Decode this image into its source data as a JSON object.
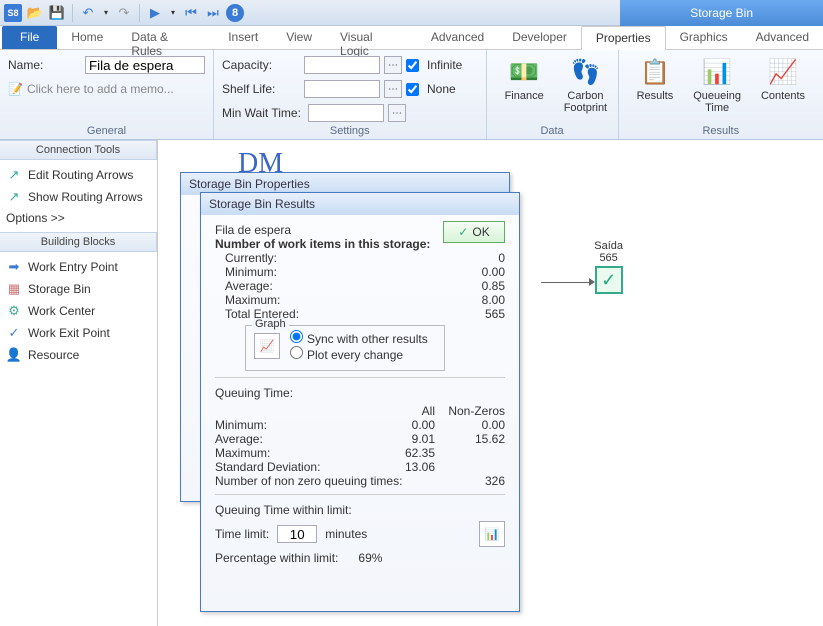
{
  "context_tab": "Storage Bin",
  "qat": {
    "undo_dropdown": "▾"
  },
  "tabs": {
    "file": "File",
    "home": "Home",
    "data_rules": "Data & Rules",
    "insert": "Insert",
    "view": "View",
    "visual_logic": "Visual Logic",
    "advanced": "Advanced",
    "developer": "Developer",
    "properties": "Properties",
    "graphics": "Graphics",
    "advanced2": "Advanced"
  },
  "general": {
    "name_label": "Name:",
    "name_value": "Fila de espera",
    "memo_placeholder": "Click here to add a memo...",
    "group_label": "General"
  },
  "settings": {
    "capacity_label": "Capacity:",
    "capacity_value": "",
    "infinite_label": "Infinite",
    "infinite_checked": true,
    "shelf_life_label": "Shelf Life:",
    "shelf_life_value": "",
    "none_label": "None",
    "none_checked": true,
    "min_wait_label": "Min Wait Time:",
    "min_wait_value": "",
    "group_label": "Settings"
  },
  "data_group": {
    "finance": "Finance",
    "carbon": "Carbon\nFootprint",
    "group_label": "Data"
  },
  "results_group": {
    "results": "Results",
    "queueing": "Queueing\nTime",
    "contents": "Contents",
    "group_label": "Results"
  },
  "side": {
    "conn_tools_hdr": "Connection Tools",
    "edit_routing": "Edit Routing Arrows",
    "show_routing": "Show Routing Arrows",
    "options": "Options >>",
    "blocks_hdr": "Building Blocks",
    "work_entry": "Work Entry Point",
    "storage_bin": "Storage Bin",
    "work_center": "Work Center",
    "work_exit": "Work Exit Point",
    "resource": "Resource"
  },
  "canvas": {
    "partial_text": "DM",
    "exit_label": "Saída",
    "exit_count": "565"
  },
  "dlg1": {
    "title": "Storage Bin Properties"
  },
  "dlg2": {
    "title": "Storage Bin Results",
    "obj_name": "Fila de espera",
    "ok": "OK",
    "header": "Number of work items in this storage:",
    "rows": {
      "currently_l": "Currently:",
      "currently_v": "0",
      "minimum_l": "Minimum:",
      "minimum_v": "0.00",
      "average_l": "Average:",
      "average_v": "0.85",
      "maximum_l": "Maximum:",
      "maximum_v": "8.00",
      "total_l": "Total Entered:",
      "total_v": "565"
    },
    "graph": {
      "legend": "Graph",
      "sync": "Sync with other results",
      "plot": "Plot every change"
    },
    "qt": {
      "header": "Queuing Time:",
      "col_all": "All",
      "col_nz": "Non-Zeros",
      "min_l": "Minimum:",
      "min_a": "0.00",
      "min_n": "0.00",
      "avg_l": "Average:",
      "avg_a": "9.01",
      "avg_n": "15.62",
      "max_l": "Maximum:",
      "max_a": "62.35",
      "std_l": "Standard Deviation:",
      "std_a": "13.06",
      "nnz_l": "Number of non zero queuing times:",
      "nnz_v": "326"
    },
    "limit": {
      "header": "Queuing Time within limit:",
      "time_l": "Time limit:",
      "time_v": "10",
      "time_unit": "minutes",
      "pct_l": "Percentage within limit:",
      "pct_v": "69%"
    }
  }
}
